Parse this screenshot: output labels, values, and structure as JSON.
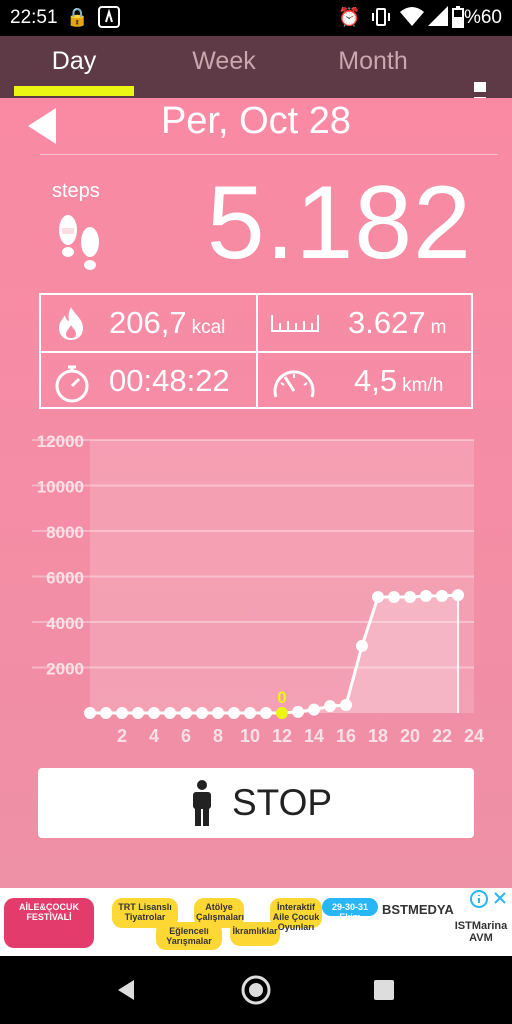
{
  "status_bar": {
    "time": "22:51",
    "battery": "%60"
  },
  "tabs": [
    {
      "label": "Day",
      "active": true
    },
    {
      "label": "Week",
      "active": false
    },
    {
      "label": "Month",
      "active": false
    }
  ],
  "date": {
    "title": "Per, Oct 28"
  },
  "steps": {
    "label": "steps",
    "count": "5.182"
  },
  "stats": {
    "calories": {
      "value": "206,7",
      "unit": "kcal"
    },
    "distance": {
      "value": "3.627",
      "unit": "m"
    },
    "duration": {
      "value": "00:48:22"
    },
    "speed": {
      "value": "4,5",
      "unit": "km/h"
    }
  },
  "chart_data": {
    "type": "area",
    "x": [
      0,
      1,
      2,
      3,
      4,
      5,
      6,
      7,
      8,
      9,
      10,
      11,
      12,
      13,
      14,
      15,
      16,
      17,
      18,
      19,
      20,
      21,
      22,
      23
    ],
    "values": [
      0,
      0,
      0,
      0,
      0,
      0,
      0,
      0,
      0,
      0,
      0,
      0,
      0,
      50,
      150,
      300,
      350,
      2950,
      5100,
      5100,
      5100,
      5150,
      5150,
      5182
    ],
    "xticks": [
      "2",
      "4",
      "6",
      "8",
      "10",
      "12",
      "14",
      "16",
      "18",
      "20",
      "22",
      "24"
    ],
    "yticks": [
      "2000",
      "4000",
      "6000",
      "8000",
      "10000",
      "12000"
    ],
    "ylim": [
      0,
      12000
    ],
    "xlim": [
      0,
      24
    ],
    "highlight": {
      "x": 12,
      "label": "0"
    },
    "colors": {
      "line": "#ffffff",
      "highlight": "#ecf614"
    }
  },
  "stop_button": {
    "label": "STOP"
  },
  "ad": {
    "festival": "AİLE&ÇOCUK FESTİVALİ",
    "items": [
      "TRT Lisanslı Tiyatrolar",
      "Eğlenceli Yarışmalar",
      "Atölye Çalışmaları",
      "İkramlıklar",
      "İnteraktif Aile Çocuk Oyunları"
    ],
    "dates": "29-30-31 Ekim",
    "sponsor": "BSTMEDYA",
    "mall": "ISTMarina AVM"
  }
}
